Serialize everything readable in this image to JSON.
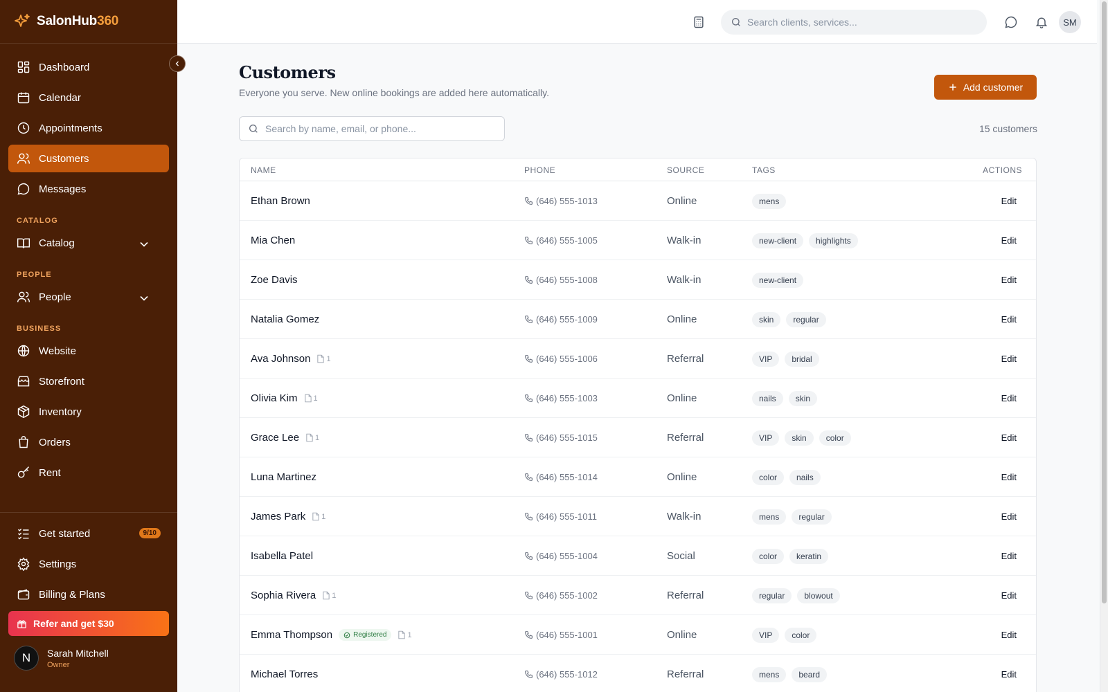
{
  "brand": {
    "name_main": "SalonHub",
    "name_accent": "360"
  },
  "sidebar": {
    "main_items": [
      {
        "label": "Dashboard",
        "icon": "dashboard-icon"
      },
      {
        "label": "Calendar",
        "icon": "calendar-icon"
      },
      {
        "label": "Appointments",
        "icon": "clock-icon"
      },
      {
        "label": "Customers",
        "icon": "users-icon",
        "active": true
      },
      {
        "label": "Messages",
        "icon": "message-icon"
      }
    ],
    "sections": {
      "catalog": {
        "title": "CATALOG",
        "item": "Catalog"
      },
      "people": {
        "title": "PEOPLE",
        "item": "People"
      },
      "business": {
        "title": "BUSINESS",
        "items": [
          "Website",
          "Storefront",
          "Inventory",
          "Orders",
          "Rent"
        ]
      }
    },
    "bottom": {
      "get_started": "Get started",
      "get_started_badge": "9/10",
      "settings": "Settings",
      "billing": "Billing & Plans",
      "refer": "Refer and get $30"
    },
    "user": {
      "initial": "N",
      "name": "Sarah Mitchell",
      "role": "Owner"
    }
  },
  "topbar": {
    "search_placeholder": "Search clients, services...",
    "avatar_initials": "SM"
  },
  "main": {
    "title": "Customers",
    "subtitle": "Everyone you serve. New online bookings are added here automatically.",
    "add_button": "Add customer",
    "search_placeholder": "Search by name, email, or phone...",
    "count": "15 customers",
    "columns": {
      "name": "NAME",
      "phone": "PHONE",
      "source": "SOURCE",
      "tags": "TAGS",
      "actions": "ACTIONS"
    },
    "edit_label": "Edit",
    "registered_label": "Registered",
    "rows": [
      {
        "name": "Ethan Brown",
        "phone": "(646) 555-1013",
        "source": "Online",
        "tags": [
          "mens"
        ],
        "notes": ""
      },
      {
        "name": "Mia Chen",
        "phone": "(646) 555-1005",
        "source": "Walk-in",
        "tags": [
          "new-client",
          "highlights"
        ],
        "notes": ""
      },
      {
        "name": "Zoe Davis",
        "phone": "(646) 555-1008",
        "source": "Walk-in",
        "tags": [
          "new-client"
        ],
        "notes": ""
      },
      {
        "name": "Natalia Gomez",
        "phone": "(646) 555-1009",
        "source": "Online",
        "tags": [
          "skin",
          "regular"
        ],
        "notes": ""
      },
      {
        "name": "Ava Johnson",
        "phone": "(646) 555-1006",
        "source": "Referral",
        "tags": [
          "VIP",
          "bridal"
        ],
        "notes": "1"
      },
      {
        "name": "Olivia Kim",
        "phone": "(646) 555-1003",
        "source": "Online",
        "tags": [
          "nails",
          "skin"
        ],
        "notes": "1"
      },
      {
        "name": "Grace Lee",
        "phone": "(646) 555-1015",
        "source": "Referral",
        "tags": [
          "VIP",
          "skin",
          "color"
        ],
        "notes": "1"
      },
      {
        "name": "Luna Martinez",
        "phone": "(646) 555-1014",
        "source": "Online",
        "tags": [
          "color",
          "nails"
        ],
        "notes": ""
      },
      {
        "name": "James Park",
        "phone": "(646) 555-1011",
        "source": "Walk-in",
        "tags": [
          "mens",
          "regular"
        ],
        "notes": "1"
      },
      {
        "name": "Isabella Patel",
        "phone": "(646) 555-1004",
        "source": "Social",
        "tags": [
          "color",
          "keratin"
        ],
        "notes": ""
      },
      {
        "name": "Sophia Rivera",
        "phone": "(646) 555-1002",
        "source": "Referral",
        "tags": [
          "regular",
          "blowout"
        ],
        "notes": "1"
      },
      {
        "name": "Emma Thompson",
        "phone": "(646) 555-1001",
        "source": "Online",
        "tags": [
          "VIP",
          "color"
        ],
        "notes": "1",
        "registered": true
      },
      {
        "name": "Michael Torres",
        "phone": "(646) 555-1012",
        "source": "Referral",
        "tags": [
          "mens",
          "beard"
        ],
        "notes": ""
      }
    ]
  },
  "colors": {
    "sidebar_bg": "#4a1f06",
    "accent": "#c2570c",
    "brand_accent": "#f59e3c"
  }
}
